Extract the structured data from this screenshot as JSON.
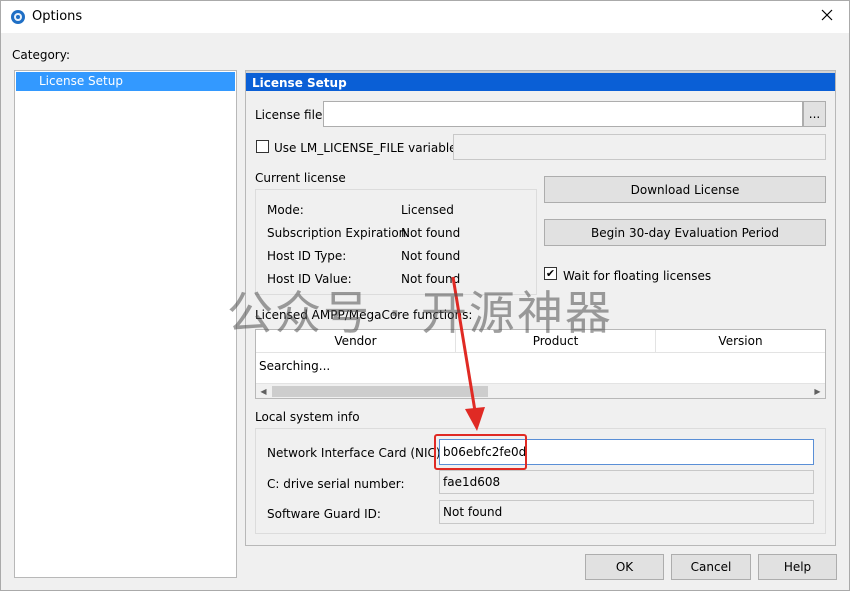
{
  "window": {
    "title": "Options",
    "icon": "app-globe-icon",
    "close_icon": "close-icon"
  },
  "category": {
    "label": "Category:",
    "items": [
      {
        "label": "License Setup",
        "selected": true
      }
    ]
  },
  "panel": {
    "header": "License Setup",
    "license_file": {
      "label": "License file:",
      "value": "",
      "browse_label": "..."
    },
    "use_lm_var": {
      "label": "Use LM_LICENSE_FILE variable:",
      "checked": false,
      "value": ""
    },
    "current_license": {
      "heading": "Current license",
      "rows": [
        {
          "key": "Mode:",
          "value": "Licensed"
        },
        {
          "key": "Subscription Expiration:",
          "value": "Not found"
        },
        {
          "key": "Host ID Type:",
          "value": "Not found"
        },
        {
          "key": "Host ID Value:",
          "value": "Not found"
        }
      ]
    },
    "download_button": "Download License",
    "evaluation_button": "Begin 30-day Evaluation Period",
    "wait_floating": {
      "label": "Wait for floating licenses",
      "checked": true
    },
    "functions": {
      "heading": "Licensed AMPP/MegaCore functions:",
      "columns": [
        "Vendor",
        "Product",
        "Version"
      ],
      "status_text": "Searching..."
    },
    "local_info": {
      "heading": "Local system info",
      "nic": {
        "label": "Network Interface Card (NIC) ID:",
        "value": "b06ebfc2fe0d"
      },
      "drive": {
        "label": "C: drive serial number:",
        "value": "fae1d608"
      },
      "guard": {
        "label": "Software Guard ID:",
        "value": "Not found"
      }
    }
  },
  "footer": {
    "ok": "OK",
    "cancel": "Cancel",
    "help": "Help"
  },
  "overlay": {
    "watermark": "公众号 · 开源神器",
    "annotation_color": "#e02a24"
  },
  "colors": {
    "accent": "#0a5fd6",
    "selection": "#3399ff"
  }
}
